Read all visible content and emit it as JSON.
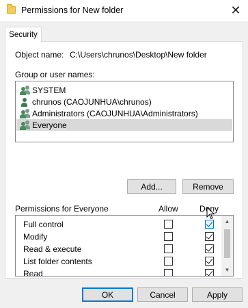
{
  "window": {
    "title": "Permissions for New folder",
    "close_glyph": "✕",
    "folder_icon": "folder-icon"
  },
  "tabs": [
    {
      "label": "Security",
      "active": true
    }
  ],
  "object": {
    "label": "Object name:",
    "value": "C:\\Users\\chrunos\\Desktop\\New folder"
  },
  "groups": {
    "label": "Group or user names:",
    "items": [
      {
        "name": "SYSTEM",
        "icon": "group-users-icon",
        "selected": false
      },
      {
        "name": "chrunos (CAOJUNHUA\\chrunos)",
        "icon": "user-icon",
        "selected": false
      },
      {
        "name": "Administrators (CAOJUNHUA\\Administrators)",
        "icon": "group-users-icon",
        "selected": false
      },
      {
        "name": "Everyone",
        "icon": "group-users-icon",
        "selected": true
      }
    ]
  },
  "buttons": {
    "add": "Add...",
    "remove": "Remove",
    "ok": "OK",
    "cancel": "Cancel",
    "apply": "Apply"
  },
  "permissions": {
    "header": "Permissions for Everyone",
    "allow_label": "Allow",
    "deny_label": "Deny",
    "rows": [
      {
        "name": "Full control",
        "allow": false,
        "deny": true
      },
      {
        "name": "Modify",
        "allow": false,
        "deny": true
      },
      {
        "name": "Read & execute",
        "allow": false,
        "deny": true
      },
      {
        "name": "List folder contents",
        "allow": false,
        "deny": true
      },
      {
        "name": "Read",
        "allow": false,
        "deny": true
      },
      {
        "name": "",
        "allow": false,
        "deny": true
      }
    ]
  },
  "colors": {
    "accent": "#0078d7",
    "selection": "#d9d9d9",
    "folder": "#f3cc5a"
  }
}
